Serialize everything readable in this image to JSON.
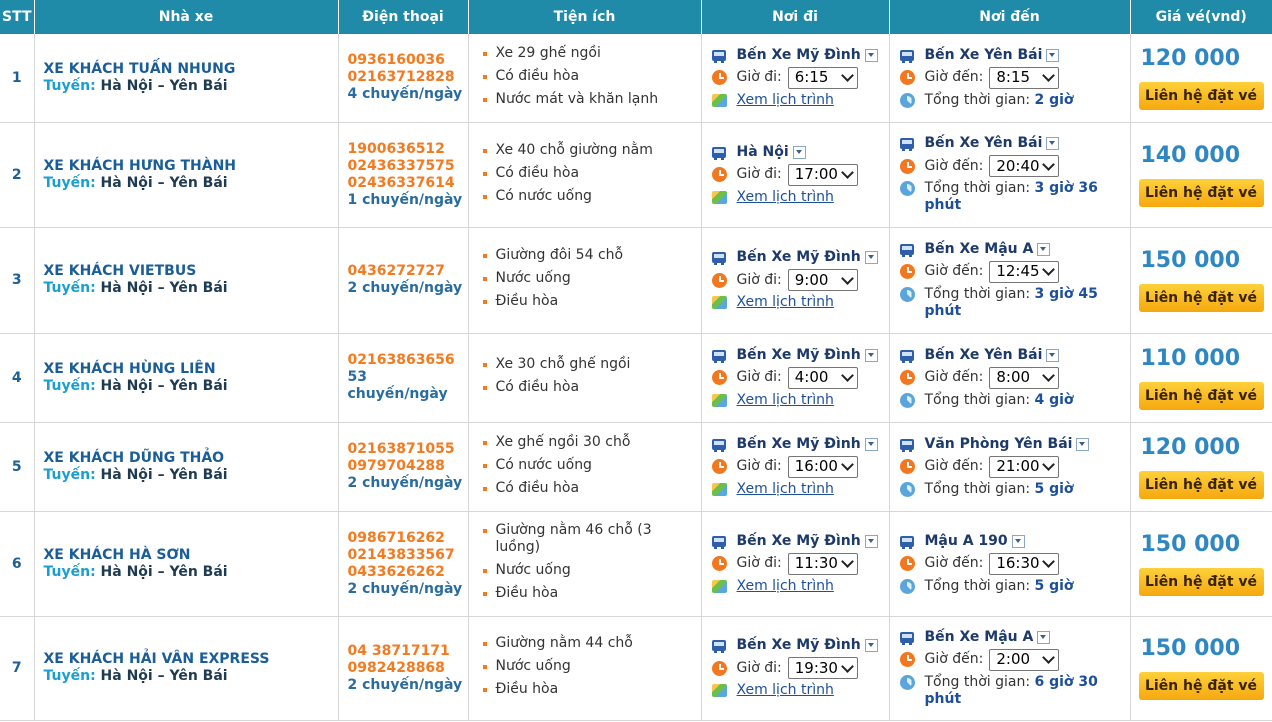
{
  "headers": {
    "stt": "STT",
    "company": "Nhà xe",
    "phone": "Điện thoại",
    "amenities": "Tiện ích",
    "departure": "Nơi đi",
    "arrival": "Nơi đến",
    "price": "Giá vé(vnd)"
  },
  "labels": {
    "route": "Tuyến:",
    "depart_time": "Giờ đi:",
    "arrive_time": "Giờ đến:",
    "schedule_link": "Xem lịch trình",
    "total_time": "Tổng thời gian:",
    "book_button": "Liên hệ đặt vé"
  },
  "icons": {
    "bus": "bus-icon",
    "clock": "clock-icon",
    "map": "map-icon",
    "duration": "duration-icon",
    "dropdown": "chevron-down-icon"
  },
  "colors": {
    "header_bg": "#1f8ba9",
    "phone": "#f47a20",
    "price": "#2e87c2",
    "button": "#f6a80f"
  },
  "rows": [
    {
      "stt": "1",
      "company": "XE KHÁCH TUẤN NHUNG",
      "route": "Hà Nội – Yên Bái",
      "phones": [
        "0936160036",
        "02163712828"
      ],
      "trips": "4 chuyến/ngày",
      "amenities": [
        "Xe 29 ghế ngồi",
        "Có điều hòa",
        "Nước mát và khăn lạnh"
      ],
      "from": "Bến Xe Mỹ Đình",
      "depart": "6:15",
      "to": "Bến Xe Yên Bái",
      "arrive": "8:15",
      "duration": "2 giờ",
      "price": "120 000"
    },
    {
      "stt": "2",
      "company": "XE KHÁCH HƯNG THÀNH",
      "route": "Hà Nội – Yên Bái",
      "phones": [
        "1900636512",
        "02436337575",
        "02436337614"
      ],
      "trips": "1 chuyến/ngày",
      "amenities": [
        "Xe 40 chỗ giường nằm",
        "Có điều hòa",
        "Có nước uống"
      ],
      "from": "Hà Nội",
      "depart": "17:00",
      "to": "Bến Xe Yên Bái",
      "arrive": "20:40",
      "duration": "3 giờ 36 phút",
      "price": "140 000"
    },
    {
      "stt": "3",
      "company": "XE KHÁCH VIETBUS",
      "route": "Hà Nội – Yên Bái",
      "phones": [
        "0436272727"
      ],
      "trips": "2 chuyến/ngày",
      "amenities": [
        "Giường đôi 54 chỗ",
        "Nước uống",
        "Điều hòa"
      ],
      "from": "Bến Xe Mỹ Đình",
      "depart": "9:00",
      "to": "Bến Xe Mậu A",
      "arrive": "12:45",
      "duration": "3 giờ 45 phút",
      "price": "150 000"
    },
    {
      "stt": "4",
      "company": "XE KHÁCH HÙNG LIÊN",
      "route": "Hà Nội – Yên Bái",
      "phones": [
        "02163863656"
      ],
      "trips": "53 chuyến/ngày",
      "amenities": [
        "Xe 30 chỗ ghế ngồi",
        "Có điều hòa"
      ],
      "from": "Bến Xe Mỹ Đình",
      "depart": "4:00",
      "to": "Bến Xe Yên Bái",
      "arrive": "8:00",
      "duration": "4 giờ",
      "price": "110 000"
    },
    {
      "stt": "5",
      "company": "XE KHÁCH DŨNG THẢO",
      "route": "Hà Nội – Yên Bái",
      "phones": [
        "02163871055",
        "0979704288"
      ],
      "trips": "2 chuyến/ngày",
      "amenities": [
        "Xe ghế ngồi 30 chỗ",
        "Có nước uống",
        "Có điều hòa"
      ],
      "from": "Bến Xe Mỹ Đình",
      "depart": "16:00",
      "to": "Văn Phòng Yên Bái",
      "arrive": "21:00",
      "duration": "5 giờ",
      "price": "120 000"
    },
    {
      "stt": "6",
      "company": "XE KHÁCH HÀ SƠN",
      "route": "Hà Nội – Yên Bái",
      "phones": [
        "0986716262",
        "02143833567",
        "0433626262"
      ],
      "trips": "2 chuyến/ngày",
      "amenities": [
        "Giường nằm 46 chỗ (3 luồng)",
        "Nước uống",
        "Điều hòa"
      ],
      "from": "Bến Xe Mỹ Đình",
      "depart": "11:30",
      "to": "Mậu A 190",
      "arrive": "16:30",
      "duration": "5 giờ",
      "price": "150 000"
    },
    {
      "stt": "7",
      "company": "XE KHÁCH HẢI VÂN EXPRESS",
      "route": "Hà Nội – Yên Bái",
      "phones": [
        "04 38717171",
        "0982428868"
      ],
      "trips": "2 chuyến/ngày",
      "amenities": [
        "Giường nằm 44 chỗ",
        "Nước uống",
        "Điều hòa"
      ],
      "from": "Bến Xe Mỹ Đình",
      "depart": "19:30",
      "to": "Bến Xe Mậu A",
      "arrive": "2:00",
      "duration": "6 giờ 30 phút",
      "price": "150 000"
    }
  ]
}
